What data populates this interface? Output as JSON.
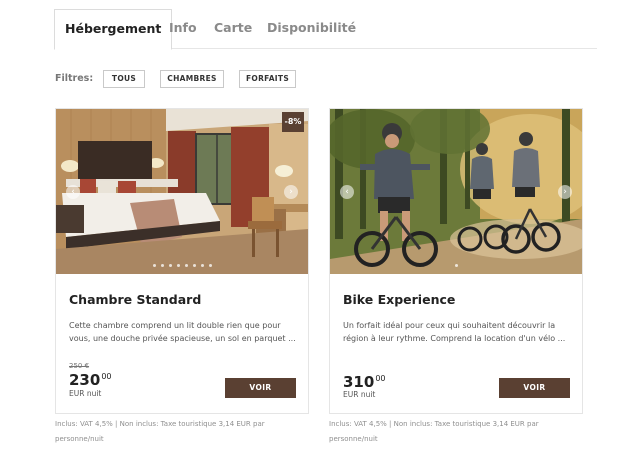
{
  "tabs": [
    {
      "label": "Hébergement",
      "active": true
    },
    {
      "label": "Info",
      "active": false
    },
    {
      "label": "Carte",
      "active": false
    },
    {
      "label": "Disponibilité",
      "active": false
    }
  ],
  "filters": {
    "label": "Filtres:",
    "options": [
      "TOUS",
      "CHAMBRES",
      "FORFAITS"
    ]
  },
  "cards": [
    {
      "badge": "-8%",
      "title": "Chambre Standard",
      "description": "Cette chambre comprend un lit double rien que pour vous, une douche privée spacieuse, un sol en parquet ...",
      "price_old": "250 €",
      "price_main": "230",
      "price_cents": "00",
      "price_unit": "EUR nuit",
      "button": "VOIR",
      "note": "Inclus: VAT 4,5% | Non inclus: Taxe touristique 3,14 EUR par personne/nuit",
      "image": "hotel-bedroom-photo"
    },
    {
      "title": "Bike Experience",
      "description": "Un forfait idéal pour ceux qui souhaitent découvrir la région à leur rythme. Comprend la location d'un vélo ...",
      "price_main": "310",
      "price_cents": "00",
      "price_unit": "EUR nuit",
      "button": "VOIR",
      "note": "Inclus: VAT 4,5% | Non inclus: Taxe touristique 3,14 EUR par personne/nuit",
      "image": "mountain-bikers-photo"
    }
  ],
  "colors": {
    "accent": "#5a4032",
    "border": "#e5e5e5"
  }
}
